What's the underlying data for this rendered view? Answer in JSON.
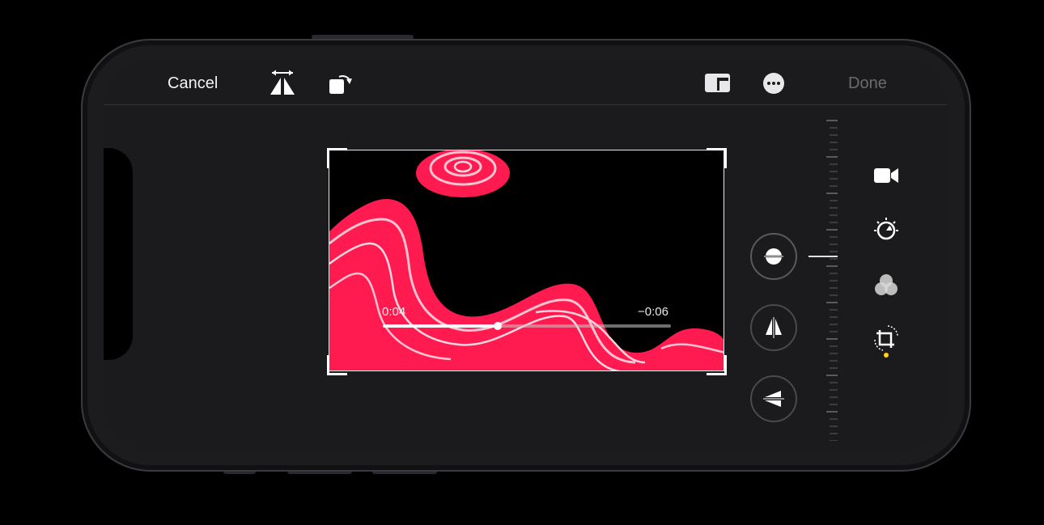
{
  "toolbar": {
    "cancel_label": "Cancel",
    "done_label": "Done"
  },
  "video": {
    "elapsed": "0:04",
    "remaining": "−0:06",
    "progress": 0.4
  },
  "straighten": {
    "level": 0.0
  },
  "sidebar": {
    "items": [
      {
        "icon": "video-camera-icon"
      },
      {
        "icon": "adjust-dial-icon"
      },
      {
        "icon": "filters-icon"
      },
      {
        "icon": "crop-rotate-icon",
        "selected": true
      }
    ]
  },
  "colors": {
    "accent": "#ffd60a",
    "neon": "#ff1e50",
    "done_disabled": "#6b6b6b"
  }
}
